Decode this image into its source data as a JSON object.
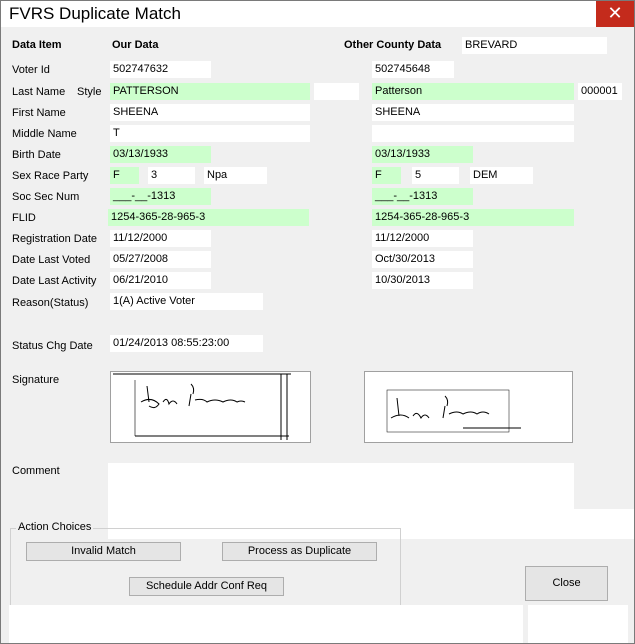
{
  "window": {
    "title": "FVRS Duplicate Match",
    "close_glyph": "✕"
  },
  "headers": {
    "data_item": "Data Item",
    "our_data": "Our Data",
    "other_county_data": "Other County Data"
  },
  "other_county_name": "BREVARD",
  "labels": {
    "voter_id": "Voter Id",
    "last_name": "Last Name",
    "style": "Style",
    "first_name": "First Name",
    "middle_name": "Middle Name",
    "birth_date": "Birth Date",
    "sex_race_party": "Sex Race Party",
    "soc_sec_num": "Soc Sec Num",
    "flid": "FLID",
    "registration_date": "Registration Date",
    "date_last_voted": "Date Last Voted",
    "date_last_activity": "Date Last Activity",
    "reason_status": "Reason(Status)",
    "status_chg_date": "Status Chg Date",
    "signature": "Signature",
    "comment": "Comment"
  },
  "our": {
    "voter_id": "502747632",
    "last_name": "PATTERSON",
    "style": "",
    "first_name": "SHEENA",
    "middle_name": "T",
    "birth_date": "03/13/1933",
    "sex": "F",
    "race": "3",
    "party": "Npa",
    "soc_sec_num": "___-__-1313",
    "flid": "1254-365-28-965-3",
    "registration_date": "11/12/2000",
    "date_last_voted": "05/27/2008",
    "date_last_activity": "06/21/2010",
    "reason_status": "1(A) Active Voter",
    "status_chg_date": "01/24/2013 08:55:23:00"
  },
  "other": {
    "voter_id": "502745648",
    "last_name": "Patterson",
    "style": "000001",
    "first_name": "SHEENA",
    "middle_name": "",
    "birth_date": "03/13/1933",
    "sex": "F",
    "race": "5",
    "party": "DEM",
    "soc_sec_num": "___-__-1313",
    "flid": "1254-365-28-965-3",
    "registration_date": "11/12/2000",
    "date_last_voted": "Oct/30/2013",
    "date_last_activity": "10/30/2013"
  },
  "comment": "",
  "actions": {
    "group_title": "Action Choices",
    "invalid_match": "Invalid Match",
    "process_duplicate": "Process as Duplicate",
    "schedule_addr": "Schedule Addr Conf Req",
    "close": "Close"
  },
  "colors": {
    "match_green": "#ccffcc",
    "close_red": "#c42b1c"
  }
}
